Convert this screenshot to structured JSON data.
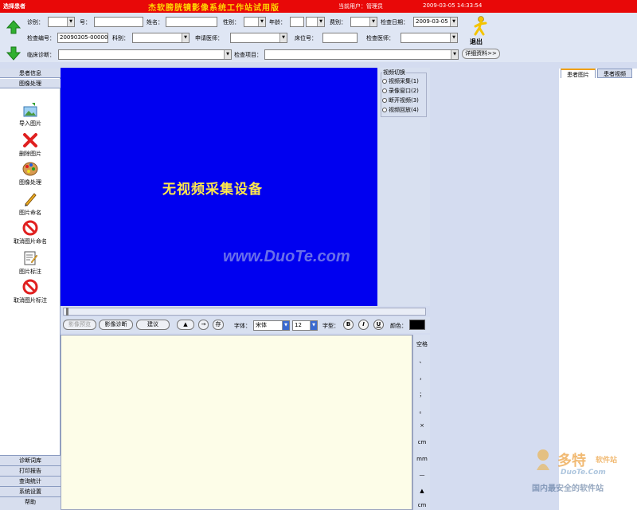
{
  "titlebar": {
    "select_patient": "选择患者",
    "app_title": "杰软膀胱镜影像系统工作站试用版",
    "current_user": "当前用户：管理员",
    "datetime": "2009-03-05 14:33:54"
  },
  "form": {
    "diag_label": "诊别：",
    "num_label": "号：",
    "name_label": "姓名：",
    "gender_label": "性别：",
    "age_label": "年龄：",
    "fee_label": "费别：",
    "exam_date_label": "检查日期：",
    "exam_date_value": "2009-03-05",
    "exam_no_label": "检查编号：",
    "exam_no_value": "20090305-000001",
    "dept_label": "科别：",
    "req_doctor_label": "申请医师：",
    "bed_label": "床位号：",
    "exam_doctor_label": "检查医师：",
    "clinical_diag_label": "临床诊断：",
    "exam_item_label": "检查项目：",
    "detail_button": "详细资料>>",
    "exit_label": "退出"
  },
  "left_tabs": {
    "patient_info": "患者信息",
    "image_processing": "图像处理"
  },
  "tools": [
    {
      "label": "导入图片",
      "icon": "import-image-icon"
    },
    {
      "label": "删除图片",
      "icon": "delete-image-icon"
    },
    {
      "label": "图像处理",
      "icon": "palette-icon"
    },
    {
      "label": "图片命名",
      "icon": "pencil-icon"
    },
    {
      "label": "取消图片命名",
      "icon": "cancel-icon"
    },
    {
      "label": "图片标注",
      "icon": "annotate-icon"
    },
    {
      "label": "取消图片标注",
      "icon": "cancel-icon"
    }
  ],
  "bottom_tabs": [
    "诊断词库",
    "打印报告",
    "查询统计",
    "系统设置",
    "帮助"
  ],
  "video": {
    "no_device": "无视频采集设备",
    "watermark": "www.DuoTe.com"
  },
  "video_switch": {
    "title": "视频切换",
    "options": [
      "视频采集(1)",
      "录像窗口(2)",
      "断开视频(3)",
      "视频回放(4)"
    ]
  },
  "toolbar": {
    "image_preview": "影像预览",
    "image_diag": "影像诊断",
    "suggest": "建议",
    "up": "▲",
    "arrow": "→",
    "save": "存",
    "font_label": "字体：",
    "font_value": "宋体",
    "size_value": "12",
    "style_label": "字型：",
    "bold": "B",
    "italic": "I",
    "underline": "U",
    "color_label": "颜色：",
    "text_color": "#000000"
  },
  "symbols": {
    "space": "空格",
    "items": [
      "、",
      "，",
      "；",
      "。",
      "×",
      "cm",
      "mm",
      "—",
      "▲",
      "cm"
    ]
  },
  "right_tabs": {
    "patient_images": "患者图片",
    "patient_video": "患者视频"
  },
  "watermark_logo": {
    "brand": "多特",
    "site": "软件站",
    "domain": "DuoTe.Com",
    "slogan": "国内最安全的软件站"
  },
  "colors": {
    "titlebar_bg": "#e80808",
    "video_bg": "#0000f0",
    "title_text": "#ffd800"
  }
}
